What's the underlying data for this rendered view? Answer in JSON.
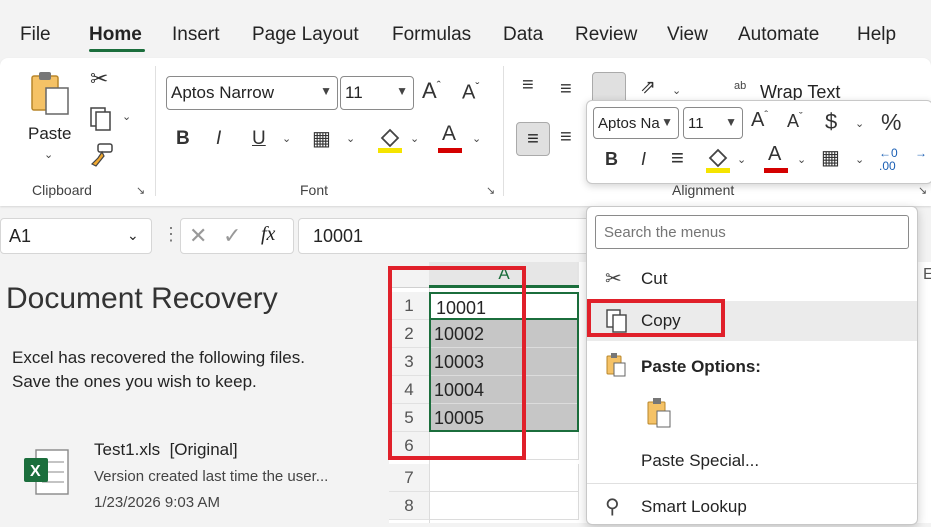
{
  "menu": {
    "tabs": [
      "File",
      "Home",
      "Insert",
      "Page Layout",
      "Formulas",
      "Data",
      "Review",
      "View",
      "Automate",
      "Help"
    ],
    "active_tab": "Home"
  },
  "ribbon": {
    "clipboard": {
      "paste_label": "Paste",
      "group_label": "Clipboard"
    },
    "font": {
      "font_name": "Aptos Narrow",
      "font_size": "11",
      "group_label": "Font"
    },
    "alignment": {
      "wrap_text": "Wrap Text",
      "group_label": "Alignment"
    }
  },
  "formula_bar": {
    "name_box": "A1",
    "fx": "fx",
    "value": "10001"
  },
  "recovery": {
    "title": "Document Recovery",
    "message_line1": "Excel has recovered the following files.",
    "message_line2": "Save the ones you wish to keep.",
    "file": {
      "name": "Test1.xls  [Original]",
      "description": "Version created last time the user...",
      "date": "1/23/2026 9:03 AM"
    }
  },
  "grid": {
    "column_header": "A",
    "next_column_header": "E",
    "rows": [
      {
        "num": "1",
        "value": "10001"
      },
      {
        "num": "2",
        "value": "10002"
      },
      {
        "num": "3",
        "value": "10003"
      },
      {
        "num": "4",
        "value": "10004"
      },
      {
        "num": "5",
        "value": "10005"
      },
      {
        "num": "6",
        "value": ""
      },
      {
        "num": "7",
        "value": ""
      },
      {
        "num": "8",
        "value": ""
      }
    ]
  },
  "mini_toolbar": {
    "font_name": "Aptos Na",
    "font_size": "11",
    "dollar": "$",
    "percent": "%"
  },
  "context_menu": {
    "search_placeholder": "Search the menus",
    "items": {
      "cut": "Cut",
      "copy": "Copy",
      "paste_options": "Paste Options:",
      "paste_special": "Paste Special...",
      "smart_lookup": "Smart Lookup"
    }
  },
  "colors": {
    "accent_green": "#1b6e3c",
    "highlight_red": "#e0202a",
    "highlight_yellow": "#f5e400",
    "font_red": "#d40000"
  }
}
